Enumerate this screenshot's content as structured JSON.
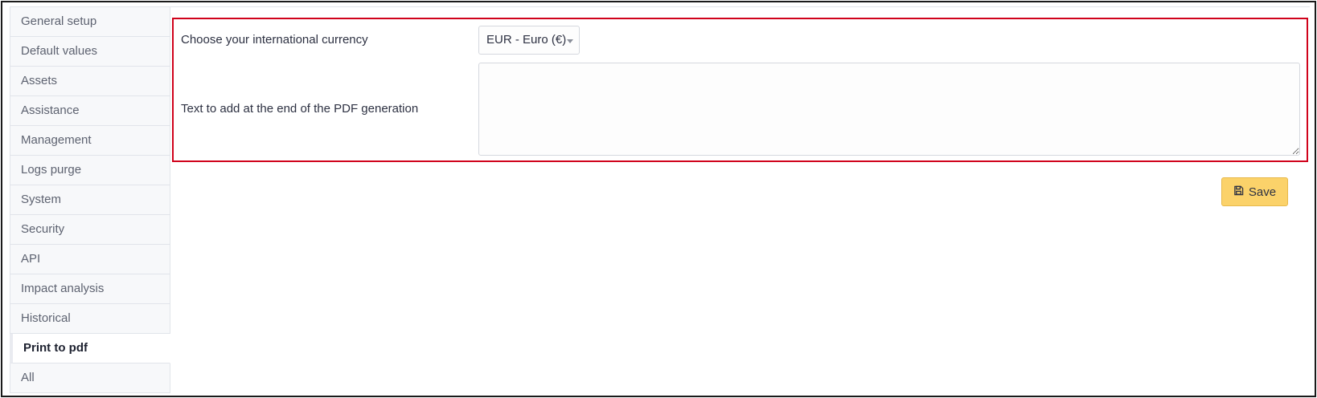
{
  "sidebar": {
    "items": [
      {
        "label": "General setup",
        "active": false
      },
      {
        "label": "Default values",
        "active": false
      },
      {
        "label": "Assets",
        "active": false
      },
      {
        "label": "Assistance",
        "active": false
      },
      {
        "label": "Management",
        "active": false
      },
      {
        "label": "Logs purge",
        "active": false
      },
      {
        "label": "System",
        "active": false
      },
      {
        "label": "Security",
        "active": false
      },
      {
        "label": "API",
        "active": false
      },
      {
        "label": "Impact analysis",
        "active": false
      },
      {
        "label": "Historical",
        "active": false
      },
      {
        "label": "Print to pdf",
        "active": true
      },
      {
        "label": "All",
        "active": false
      }
    ]
  },
  "form": {
    "currency_label": "Choose your international currency",
    "currency_value": "EUR - Euro (€)",
    "pdf_text_label": "Text to add at the end of the PDF generation",
    "pdf_text_value": ""
  },
  "actions": {
    "save_label": "Save"
  },
  "colors": {
    "highlight": "#d0021b",
    "save_bg": "#fbd26a"
  }
}
